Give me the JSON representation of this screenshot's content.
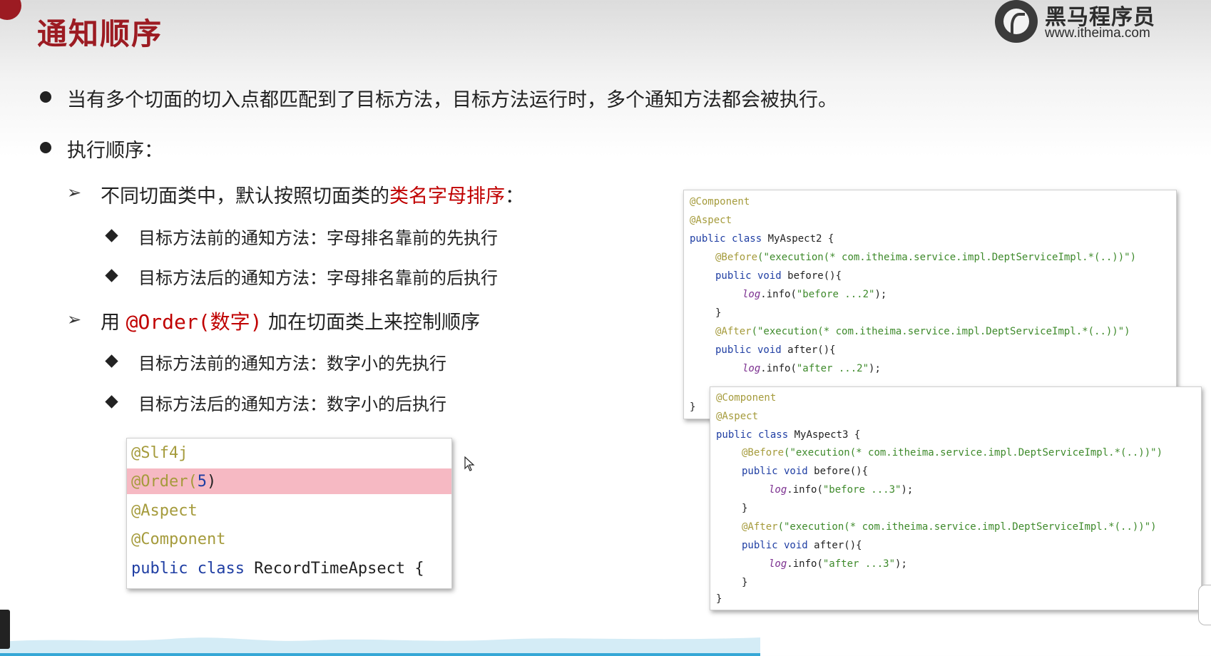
{
  "header": {
    "title": "通知顺序",
    "logo_cn": "黑马程序员",
    "logo_url": "www.itheima.com"
  },
  "bullets": {
    "b1": "当有多个切面的切入点都匹配到了目标方法，目标方法运行时，多个通知方法都会被执行。",
    "b2": "执行顺序："
  },
  "rule1": {
    "prefix": "不同切面类中，默认按照切面类的",
    "highlight": "类名字母排序",
    "suffix": "：",
    "items": [
      "目标方法前的通知方法：字母排名靠前的先执行",
      "目标方法后的通知方法：字母排名靠前的后执行"
    ]
  },
  "rule2": {
    "prefix": "用 ",
    "code": "@Order(数字)",
    "suffix": " 加在切面类上来控制顺序",
    "items": [
      "目标方法前的通知方法：数字小的先执行",
      "目标方法后的通知方法：数字小的后执行"
    ]
  },
  "order_snippet": {
    "l1": "@Slf4j",
    "l2_ann": "@Order(",
    "l2_num": "5",
    "l2_end": ")",
    "l3": "@Aspect",
    "l4": "@Component",
    "l5_kw1": "public",
    "l5_kw2": "class",
    "l5_rest": " RecordTimeApsect {"
  },
  "aspect2": {
    "component": "@Component",
    "aspect": "@Aspect",
    "decl_kw": "public class",
    "decl_name": " MyAspect2 {",
    "before_ann": "@Before",
    "before_expr": "(\"execution(* com.itheima.service.impl.DeptServiceImpl.*(..))\")",
    "before_sig_kw": "public void",
    "before_sig": " before(){",
    "before_log": "log",
    "before_info": ".info(",
    "before_str": "\"before ...2\"",
    "before_end": ");",
    "close1": "}",
    "after_ann": "@After",
    "after_expr": "(\"execution(* com.itheima.service.impl.DeptServiceImpl.*(..))\")",
    "after_sig_kw": "public void",
    "after_sig": " after(){",
    "after_log": "log",
    "after_info": ".info(",
    "after_str": "\"after ...2\"",
    "after_end": ");",
    "close_class": "}"
  },
  "aspect3": {
    "component": "@Component",
    "aspect": "@Aspect",
    "decl_kw": "public class",
    "decl_name": " MyAspect3 {",
    "before_ann": "@Before",
    "before_expr": "(\"execution(* com.itheima.service.impl.DeptServiceImpl.*(..))\")",
    "before_sig_kw": "public void",
    "before_sig": " before(){",
    "before_log": "log",
    "before_info": ".info(",
    "before_str": "\"before ...3\"",
    "before_end": ");",
    "close1": "}",
    "after_ann": "@After",
    "after_expr": "(\"execution(* com.itheima.service.impl.DeptServiceImpl.*(..))\")",
    "after_sig_kw": "public void",
    "after_sig": " after(){",
    "after_log": "log",
    "after_info": ".info(",
    "after_str": "\"after ...3\"",
    "after_end": ");",
    "close2": "}",
    "close_class": "}"
  },
  "colors": {
    "brand_red": "#9c1b22",
    "highlight_red": "#c00000",
    "highlight_row": "#f6b9c3"
  }
}
